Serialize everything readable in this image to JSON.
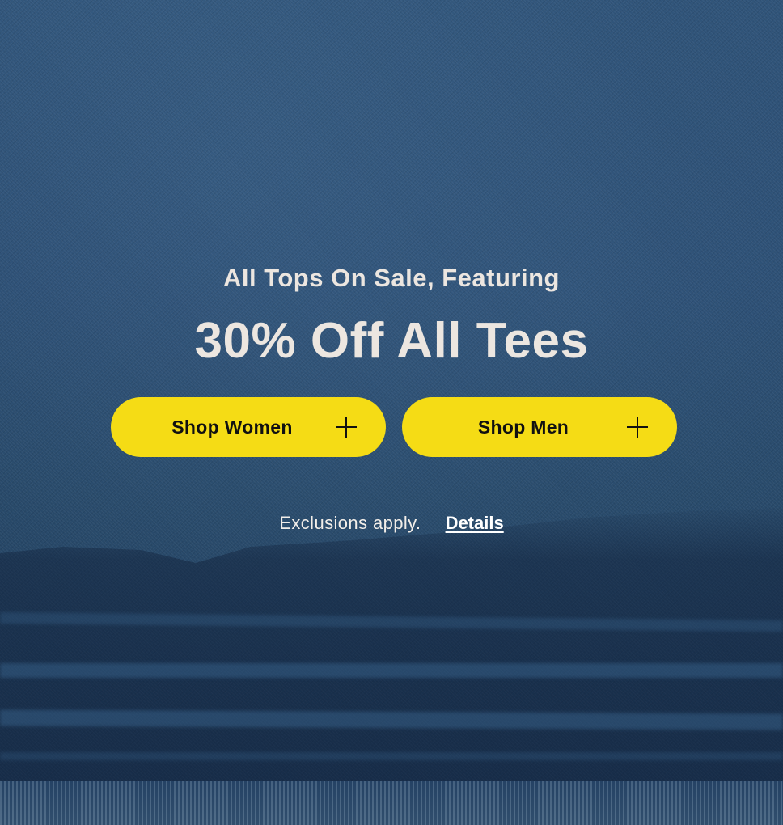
{
  "promo": {
    "subheading": "All Tops On Sale, Featuring",
    "headline": "30% Off All Tees"
  },
  "buttons": {
    "women_label": "Shop Women",
    "men_label": "Shop Men",
    "icon": "plus-icon"
  },
  "footer": {
    "exclusions": "Exclusions apply.",
    "details_link": "Details"
  },
  "colors": {
    "background": "#2b4d72",
    "text_light": "#ece6e0",
    "button_yellow": "#f5dc15",
    "button_text": "#111111"
  }
}
